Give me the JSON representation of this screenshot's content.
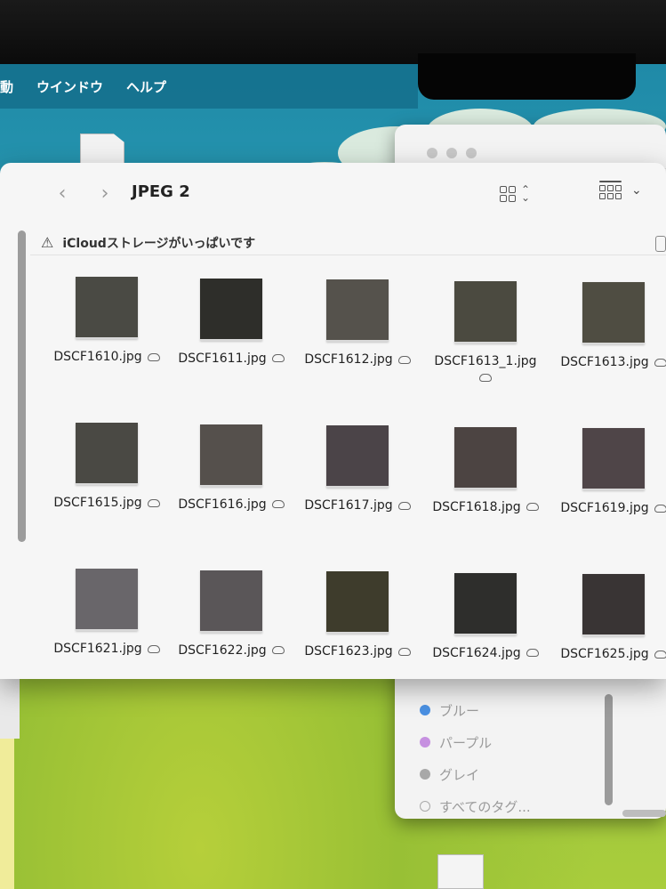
{
  "menubar": {
    "items": [
      "動",
      "ウインドウ",
      "ヘルプ"
    ]
  },
  "finder": {
    "title": "JPEG 2",
    "nav": {
      "back_icon": "chevron-left-icon",
      "forward_icon": "chevron-right-icon"
    },
    "warning": {
      "icon": "warning-triangle-icon",
      "text": "iCloudストレージがいっぱいです"
    },
    "files": [
      {
        "name": "DSCF1610.jpg",
        "color": "#4a4a44"
      },
      {
        "name": "DSCF1611.jpg",
        "color": "#2e2e2a"
      },
      {
        "name": "DSCF1612.jpg",
        "color": "#55524c"
      },
      {
        "name": "DSCF1613_1.jpg",
        "color": "#4b4a40"
      },
      {
        "name": "DSCF1613.jpg",
        "color": "#4f4d42"
      },
      {
        "name": "DSCF1615.jpg",
        "color": "#4a4944"
      },
      {
        "name": "DSCF1616.jpg",
        "color": "#55504c"
      },
      {
        "name": "DSCF1617.jpg",
        "color": "#4b4448"
      },
      {
        "name": "DSCF1618.jpg",
        "color": "#4c4442"
      },
      {
        "name": "DSCF1619.jpg",
        "color": "#4f4548"
      },
      {
        "name": "DSCF1621.jpg",
        "color": "#69666a"
      },
      {
        "name": "DSCF1622.jpg",
        "color": "#5a5658"
      },
      {
        "name": "DSCF1623.jpg",
        "color": "#3e3c2c"
      },
      {
        "name": "DSCF1624.jpg",
        "color": "#2e2e2c"
      },
      {
        "name": "DSCF1625.jpg",
        "color": "#393434"
      }
    ]
  },
  "sidebar": {
    "tags": [
      {
        "label": "ブルー",
        "color": "#4a90e2"
      },
      {
        "label": "パープル",
        "color": "#c690e0"
      },
      {
        "label": "グレイ",
        "color": "#a8a8a8"
      },
      {
        "label": "すべてのタグ..."
      }
    ]
  }
}
